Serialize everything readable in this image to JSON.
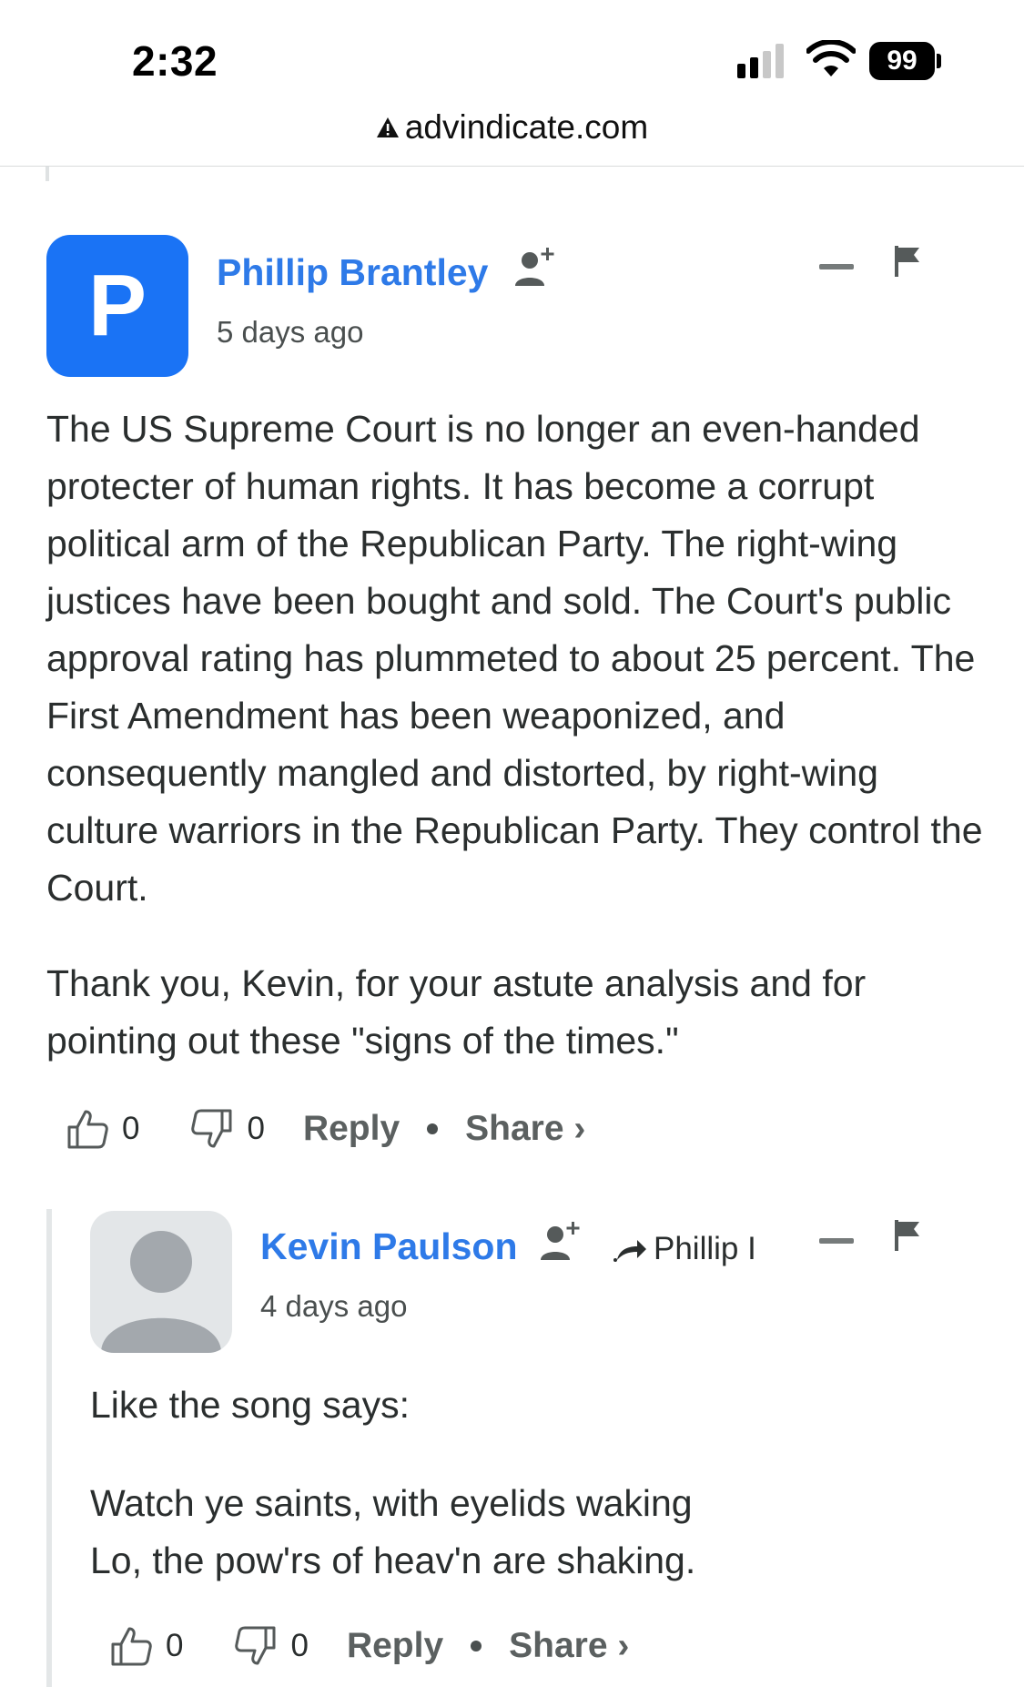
{
  "status_bar": {
    "time": "2:32",
    "battery_level": "99"
  },
  "browser": {
    "url": "advindicate.com"
  },
  "comments": [
    {
      "avatar_letter": "P",
      "author": "Phillip Brantley",
      "time_ago": "5 days ago",
      "paragraphs": [
        "The US Supreme Court is no longer an even-handed protecter of human rights. It has become a corrupt political arm of the Republican Party. The right-wing justices have been bought and sold. The Court's public approval rating has plummeted to about 25 percent. The First Amendment has been weaponized, and consequently mangled and distorted, by right-wing culture warriors in the Republican Party. They control the Court.",
        "Thank you, Kevin, for your astute analysis and for pointing out these \"signs of the times.\""
      ],
      "upvotes": "0",
      "downvotes": "0",
      "reply_label": "Reply",
      "share_label": "Share ›"
    },
    {
      "author": "Kevin Paulson",
      "in_reply_to": "Phillip I",
      "time_ago": "4 days ago",
      "paragraphs": [
        "Like the song says:",
        "Watch ye saints, with eyelids waking",
        "Lo, the pow'rs of heav'n are shaking."
      ],
      "upvotes": "0",
      "downvotes": "0",
      "reply_label": "Reply",
      "share_label": "Share ›"
    }
  ],
  "colors": {
    "author_link": "#2e7ae8",
    "avatar_blue": "#1a73f5"
  }
}
